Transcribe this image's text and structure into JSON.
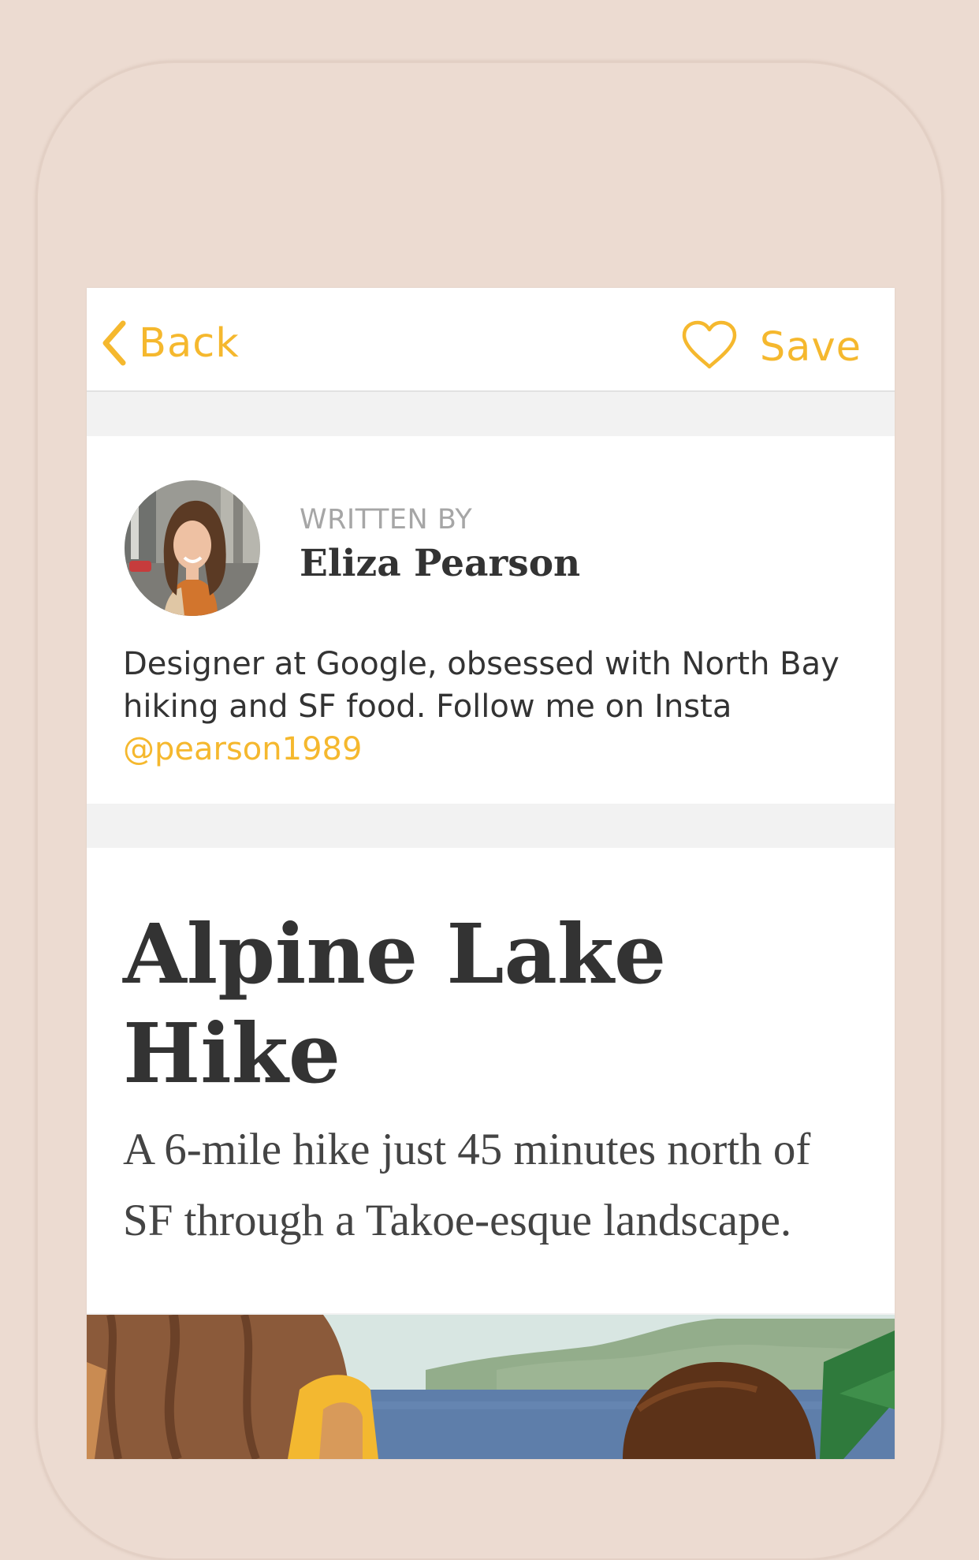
{
  "navbar": {
    "back_label": "Back",
    "save_label": "Save",
    "back_icon": "chevron-left-icon",
    "save_icon": "heart-outline-icon",
    "accent_color": "#f5b82e"
  },
  "author": {
    "written_by_label": "WRITTEN BY",
    "name": "Eliza Pearson",
    "bio_text": "Designer at Google, obsessed with North Bay hiking and SF food. Follow me on Insta",
    "insta_handle": "@pearson1989"
  },
  "article": {
    "title_line1": "Alpine Lake",
    "title_line2": "Hike",
    "subtitle": "A 6-mile hike just 45 minutes north of SF through a Takoe-esque landscape."
  },
  "colors": {
    "page_background": "#ecdbd1",
    "text_dark": "#333333",
    "text_muted": "#a6a6a6",
    "divider": "#f2f2f2"
  }
}
